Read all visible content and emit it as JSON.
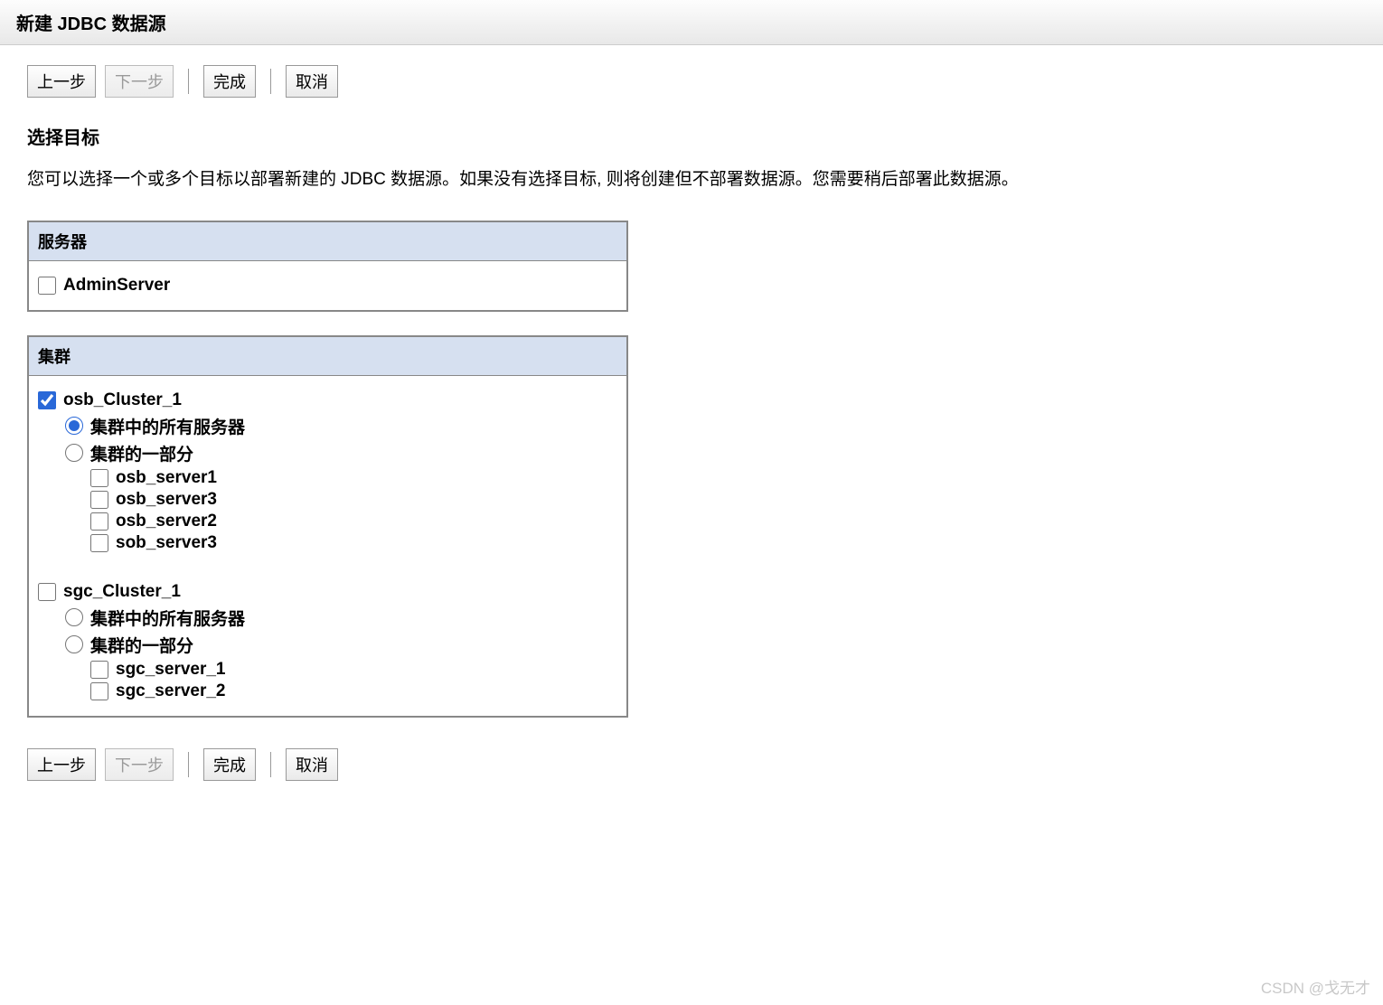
{
  "header": {
    "title": "新建 JDBC 数据源"
  },
  "buttons": {
    "back": "上一步",
    "next": "下一步",
    "finish": "完成",
    "cancel": "取消"
  },
  "section": {
    "title": "选择目标",
    "description": "您可以选择一个或多个目标以部署新建的 JDBC 数据源。如果没有选择目标, 则将创建但不部署数据源。您需要稍后部署此数据源。"
  },
  "panels": {
    "servers": {
      "title": "服务器",
      "items": [
        {
          "name": "AdminServer",
          "checked": false
        }
      ]
    },
    "clusters": {
      "title": "集群",
      "items": [
        {
          "name": "osb_Cluster_1",
          "checked": true,
          "radio_all": "集群中的所有服务器",
          "radio_part": "集群的一部分",
          "radio_selected": "all",
          "servers": [
            {
              "name": "osb_server1",
              "checked": false
            },
            {
              "name": "osb_server3",
              "checked": false
            },
            {
              "name": "osb_server2",
              "checked": false
            },
            {
              "name": "sob_server3",
              "checked": false
            }
          ]
        },
        {
          "name": "sgc_Cluster_1",
          "checked": false,
          "radio_all": "集群中的所有服务器",
          "radio_part": "集群的一部分",
          "radio_selected": "",
          "servers": [
            {
              "name": "sgc_server_1",
              "checked": false
            },
            {
              "name": "sgc_server_2",
              "checked": false
            }
          ]
        }
      ]
    }
  },
  "watermark": "CSDN @戈无才"
}
